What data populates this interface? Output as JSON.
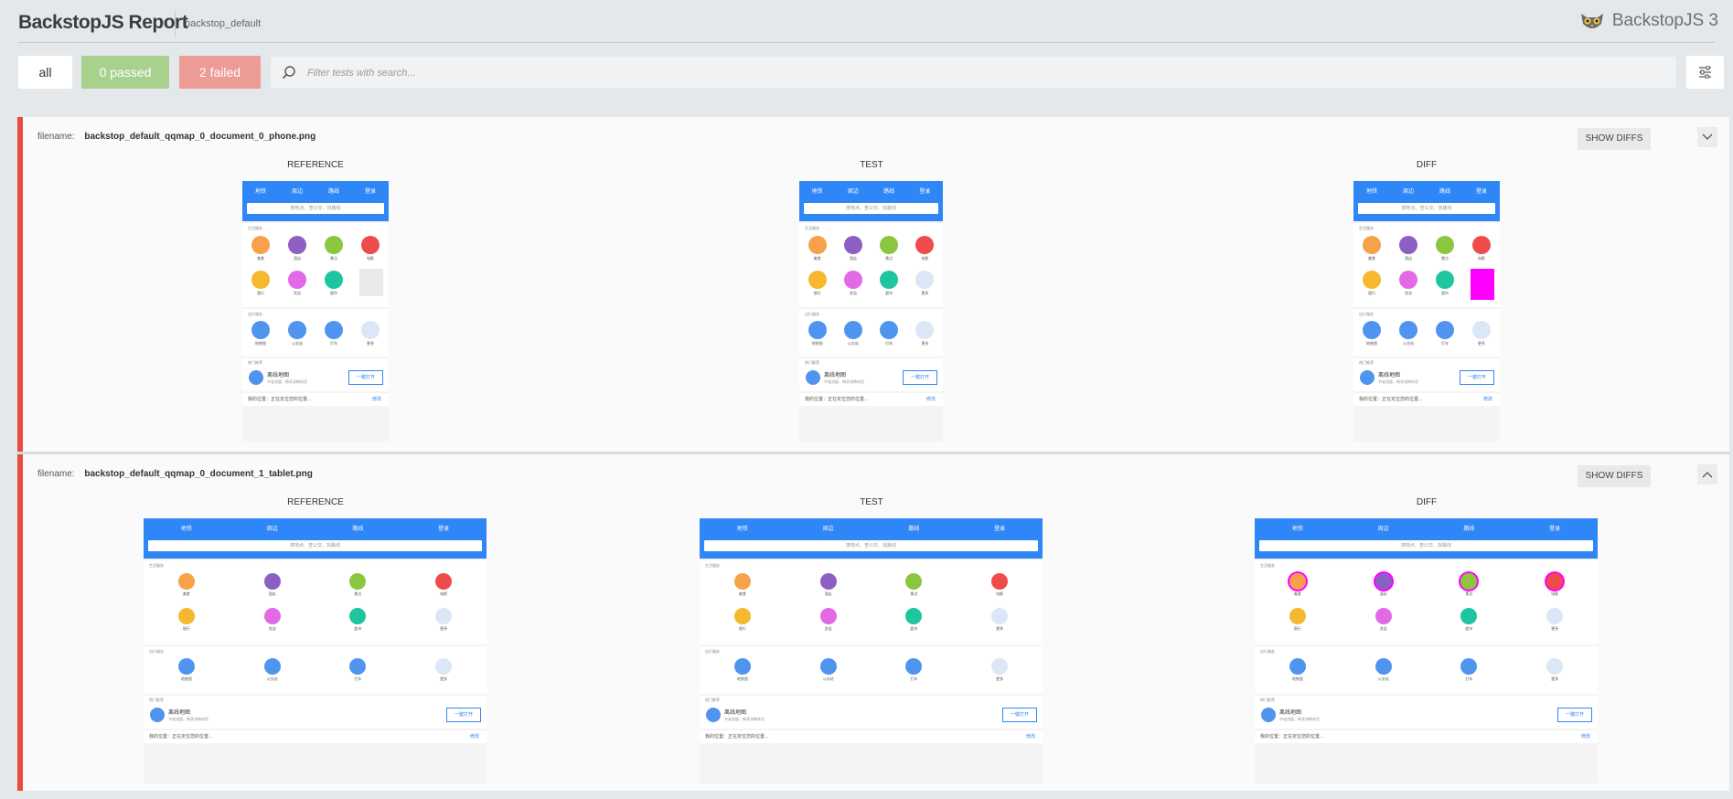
{
  "header": {
    "title": "BackstopJS Report",
    "suite": "backstop_default",
    "logo_text": "BackstopJS 3"
  },
  "filters": {
    "all": "all",
    "passed": "0 passed",
    "failed": "2 failed",
    "search_placeholder": "Filter tests with search..."
  },
  "tests": [
    {
      "filename_label": "filename:",
      "filename": "backstop_default_qqmap_0_document_0_phone.png",
      "show_diffs": "SHOW DIFFS",
      "columns": [
        "REFERENCE",
        "TEST",
        "DIFF"
      ]
    },
    {
      "filename_label": "filename:",
      "filename": "backstop_default_qqmap_0_document_1_tablet.png",
      "show_diffs": "SHOW DIFFS",
      "columns": [
        "REFERENCE",
        "TEST",
        "DIFF"
      ]
    }
  ],
  "shot": {
    "tabs": [
      "地铁",
      "周边",
      "路线",
      "登录"
    ],
    "search": "搜地点、查公交、找路线",
    "section1": "生活服务",
    "section2": "出行服务",
    "section3": "热门推荐",
    "icons1": [
      "美食",
      "酒店",
      "景点",
      "电影",
      "银行",
      "洗浴",
      "超市",
      "更多"
    ],
    "icons2": [
      "地铁图",
      "公交站",
      "打车",
      "更多"
    ],
    "offline_title": "离线地图",
    "offline_sub": "节省流量，畅享流畅体验",
    "open_btn": "一键打开",
    "location": "我的位置：正在定位您的位置...",
    "location_link": "修改"
  },
  "colors": {
    "accent_blue": "#2f86f6",
    "fail_red": "#e74c3c",
    "passed_green": "#a9d18e",
    "failed_red": "#ec9b96",
    "diff_magenta": "#ff00ff"
  }
}
